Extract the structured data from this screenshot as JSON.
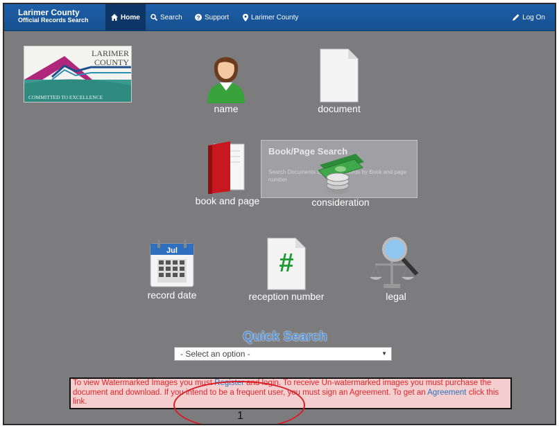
{
  "navbar": {
    "brand_line1": "Larimer County",
    "brand_line2": "Official Records Search",
    "items": [
      {
        "label": "Home",
        "icon": "home-icon"
      },
      {
        "label": "Search",
        "icon": "search-icon"
      },
      {
        "label": "Support",
        "icon": "question-icon"
      },
      {
        "label": "Larimer County",
        "icon": "map-marker-icon"
      }
    ],
    "login_label": "Log On"
  },
  "logo": {
    "line1": "LARIMER",
    "line2": "COUNTY",
    "tagline": "COMMITTED TO EXCELLENCE"
  },
  "tiles": {
    "name": "name",
    "document": "document",
    "book_page": "book and page",
    "consideration": "consideration",
    "record_date": "record date",
    "reception_number": "reception number",
    "legal": "legal",
    "calendar_month": "Jul"
  },
  "tooltip": {
    "title": "Book/Page Search",
    "desc": "Search Documents by official records by Book and page number"
  },
  "quick_search": {
    "title": "Quick Search",
    "selected": "- Select an option -"
  },
  "notice": {
    "t1": "To view Watermarked Images you must ",
    "register": "Register",
    "t2": " and login. To receive Un-watermarked images you must purchase the document and download. If you intend to be a frequent user, you must sign an Agreement. To get an ",
    "agreement": "Agreement",
    "t3": " click this link."
  },
  "annotation": {
    "number": "1",
    "color": "#d91c24"
  }
}
